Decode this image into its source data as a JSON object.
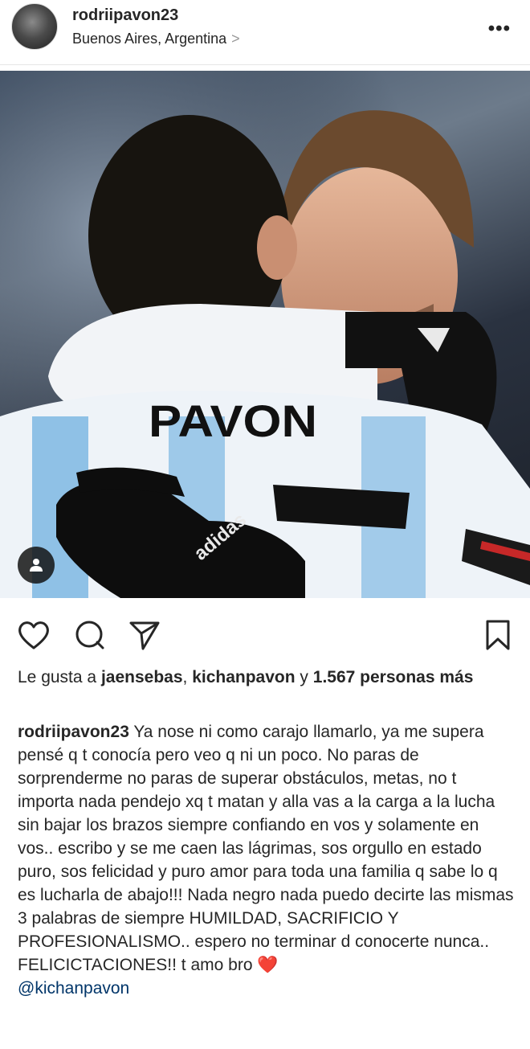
{
  "post": {
    "username": "rodriipavon23",
    "location": "Buenos Aires, Argentina",
    "location_chevron": ">",
    "more_label": "•••",
    "photo": {
      "jersey_text": "PAVON",
      "brand": "adidas"
    },
    "likes": {
      "prefix": "Le gusta a",
      "user1": "jaensebas",
      "separator": ",",
      "user2": "kichanpavon",
      "conj": "y",
      "count": "1.567",
      "suffix": "personas más"
    },
    "caption": {
      "username": "rodriipavon23",
      "text": "Ya nose ni como carajo llamarlo, ya me supera pensé q t conocía pero veo q ni un poco. No paras de sorprenderme no paras de superar obstáculos, metas, no t importa nada pendejo xq t matan y alla vas a la carga a la lucha sin bajar los brazos siempre confiando en vos y solamente en vos.. escribo y se me caen las lágrimas, sos orgullo en estado puro, sos felicidad y puro amor para toda una familia q sabe lo q es lucharla de abajo!!! Nada negro nada puedo decirte las mismas 3 palabras de siempre HUMILDAD, SACRIFICIO Y PROFESIONALISMO.. espero no terminar d conocerte nunca.. FELICICTACIONES!! t amo bro",
      "emoji": "❤️",
      "mention": "@kichanpavon"
    }
  },
  "icons": {
    "like": "heart-outline-icon",
    "comment": "comment-bubble-icon",
    "share": "paper-plane-icon",
    "save": "bookmark-icon",
    "tag": "user-tag-icon",
    "more": "more-options-icon"
  },
  "colors": {
    "text": "#262626",
    "mention": "#003569",
    "heart_emoji": "#e0252b"
  }
}
